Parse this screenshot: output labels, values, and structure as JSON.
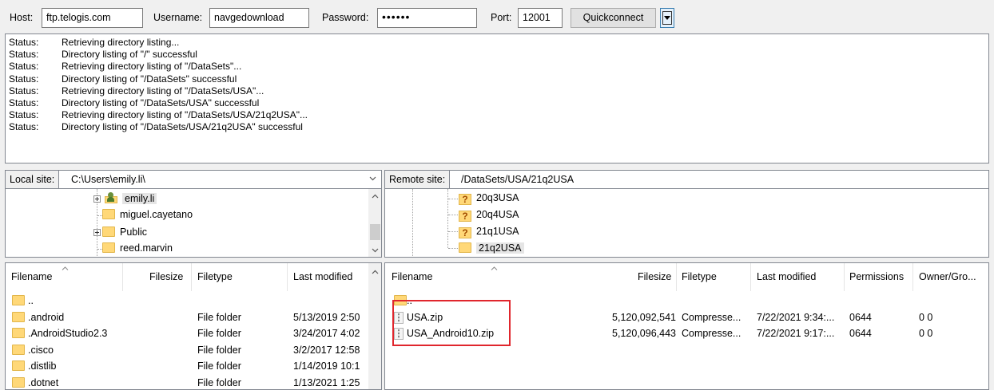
{
  "quickconnect": {
    "host_label": "Host:",
    "host_value": "ftp.telogis.com",
    "username_label": "Username:",
    "username_value": "navgedownload",
    "password_label": "Password:",
    "password_value": "••••••",
    "port_label": "Port:",
    "port_value": "12001",
    "button_label": "Quickconnect"
  },
  "log": [
    {
      "key": "Status:",
      "msg": "Retrieving directory listing..."
    },
    {
      "key": "Status:",
      "msg": "Directory listing of \"/\" successful"
    },
    {
      "key": "Status:",
      "msg": "Retrieving directory listing of \"/DataSets\"..."
    },
    {
      "key": "Status:",
      "msg": "Directory listing of \"/DataSets\" successful"
    },
    {
      "key": "Status:",
      "msg": "Retrieving directory listing of \"/DataSets/USA\"..."
    },
    {
      "key": "Status:",
      "msg": "Directory listing of \"/DataSets/USA\" successful"
    },
    {
      "key": "Status:",
      "msg": "Retrieving directory listing of \"/DataSets/USA/21q2USA\"..."
    },
    {
      "key": "Status:",
      "msg": "Directory listing of \"/DataSets/USA/21q2USA\" successful"
    }
  ],
  "local": {
    "label": "Local site:",
    "path": "C:\\Users\\emily.li\\",
    "tree": [
      "emily.li",
      "miguel.cayetano",
      "Public",
      "reed.marvin"
    ],
    "columns": [
      "Filename",
      "Filesize",
      "Filetype",
      "Last modified"
    ],
    "rows": [
      {
        "name": "..",
        "size": "",
        "type": "",
        "modified": ""
      },
      {
        "name": ".android",
        "size": "",
        "type": "File folder",
        "modified": "5/13/2019 2:50"
      },
      {
        "name": ".AndroidStudio2.3",
        "size": "",
        "type": "File folder",
        "modified": "3/24/2017 4:02"
      },
      {
        "name": ".cisco",
        "size": "",
        "type": "File folder",
        "modified": "3/2/2017 12:58"
      },
      {
        "name": ".distlib",
        "size": "",
        "type": "File folder",
        "modified": "1/14/2019 10:1"
      },
      {
        "name": ".dotnet",
        "size": "",
        "type": "File folder",
        "modified": "1/13/2021 1:25"
      }
    ]
  },
  "remote": {
    "label": "Remote site:",
    "path": "/DataSets/USA/21q2USA",
    "tree": [
      "20q3USA",
      "20q4USA",
      "21q1USA",
      "21q2USA"
    ],
    "columns": [
      "Filename",
      "Filesize",
      "Filetype",
      "Last modified",
      "Permissions",
      "Owner/Gro..."
    ],
    "rows": [
      {
        "name": "..",
        "size": "",
        "type": "",
        "modified": "",
        "perm": "",
        "owner": ""
      },
      {
        "name": "USA.zip",
        "size": "5,120,092,541",
        "type": "Compresse...",
        "modified": "7/22/2021 9:34:...",
        "perm": "0644",
        "owner": "0 0"
      },
      {
        "name": "USA_Android10.zip",
        "size": "5,120,096,443",
        "type": "Compresse...",
        "modified": "7/22/2021 9:17:...",
        "perm": "0644",
        "owner": "0 0"
      }
    ]
  }
}
